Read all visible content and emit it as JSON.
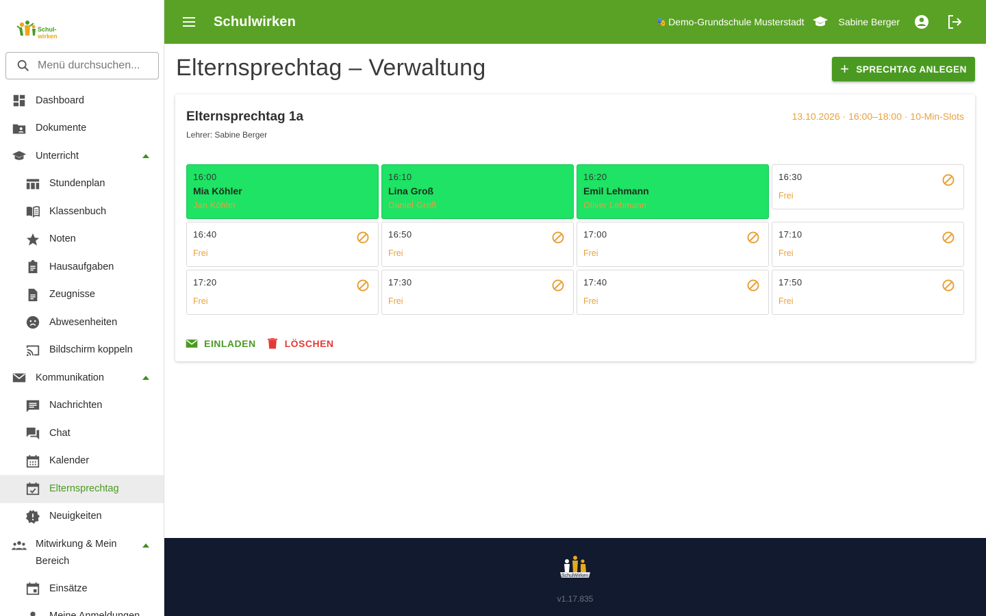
{
  "sidebar": {
    "search_placeholder": "Menü durchsuchen...",
    "items": [
      {
        "label": "Dashboard"
      },
      {
        "label": "Dokumente"
      },
      {
        "label": "Unterricht"
      },
      {
        "label": "Stundenplan"
      },
      {
        "label": "Klassenbuch"
      },
      {
        "label": "Noten"
      },
      {
        "label": "Hausaufgaben"
      },
      {
        "label": "Zeugnisse"
      },
      {
        "label": "Abwesenheiten"
      },
      {
        "label": "Bildschirm koppeln"
      },
      {
        "label": "Kommunikation"
      },
      {
        "label": "Nachrichten"
      },
      {
        "label": "Chat"
      },
      {
        "label": "Kalender"
      },
      {
        "label": "Elternsprechtag"
      },
      {
        "label": "Neuigkeiten"
      },
      {
        "label": "Mitwirkung & Mein Bereich"
      },
      {
        "label": "Einsätze"
      },
      {
        "label": "Meine Anmeldungen"
      }
    ],
    "active_item": "Elternsprechtag"
  },
  "topbar": {
    "app_title": "Schulwirken",
    "school_name": "Demo-Grundschule Musterstadt",
    "user_name": "Sabine Berger"
  },
  "page": {
    "title": "Elternsprechtag – Verwaltung",
    "create_button": "SPRECHTAG ANLEGEN"
  },
  "card": {
    "title": "Elternsprechtag 1a",
    "teacher": "Lehrer: Sabine Berger",
    "meta": "13.10.2026 · 16:00–18:00 · 10-Min-Slots",
    "slots": [
      {
        "time": "16:00",
        "student": "Mia Köhler",
        "parent": "Jan Köhler"
      },
      {
        "time": "16:10",
        "student": "Lina Groß",
        "parent": "Daniel Groß"
      },
      {
        "time": "16:20",
        "student": "Emil Lehmann",
        "parent": "Oliver Lehmann"
      },
      {
        "time": "16:30",
        "status": "Frei"
      },
      {
        "time": "16:40",
        "status": "Frei"
      },
      {
        "time": "16:50",
        "status": "Frei"
      },
      {
        "time": "17:00",
        "status": "Frei"
      },
      {
        "time": "17:10",
        "status": "Frei"
      },
      {
        "time": "17:20",
        "status": "Frei"
      },
      {
        "time": "17:30",
        "status": "Frei"
      },
      {
        "time": "17:40",
        "status": "Frei"
      },
      {
        "time": "17:50",
        "status": "Frei"
      }
    ],
    "invite_label": "EINLADEN",
    "delete_label": "LÖSCHEN"
  },
  "footer": {
    "version": "v1.17.835"
  },
  "colors": {
    "brand_green": "#5aa225",
    "booked_slot": "#1ee364",
    "accent_orange": "#e9a13b",
    "delete_red": "#e53935",
    "footer_bg": "#111a2e"
  }
}
